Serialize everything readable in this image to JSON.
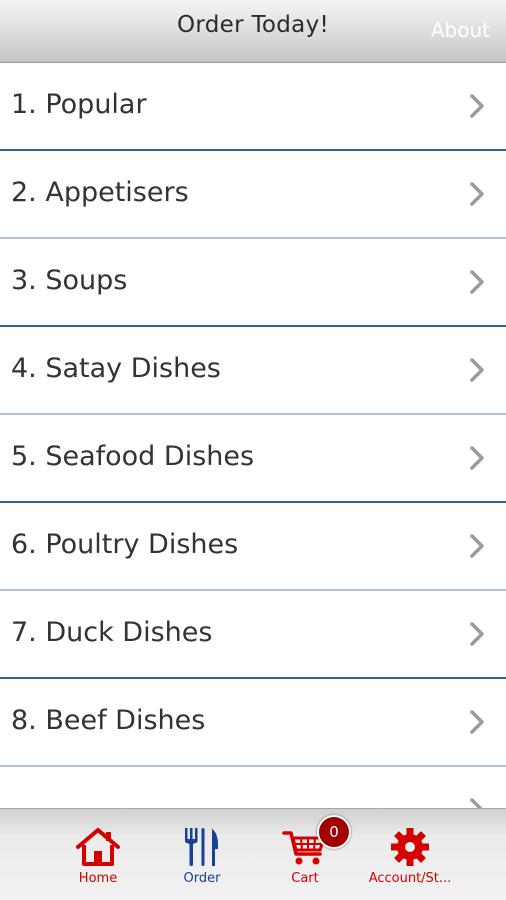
{
  "header": {
    "title": "Order Today!",
    "about_label": "About"
  },
  "menu": {
    "categories": [
      {
        "label": "1. Popular"
      },
      {
        "label": "2. Appetisers"
      },
      {
        "label": "3. Soups"
      },
      {
        "label": "4. Satay Dishes"
      },
      {
        "label": "5. Seafood Dishes"
      },
      {
        "label": "6. Poultry Dishes"
      },
      {
        "label": "7. Duck Dishes"
      },
      {
        "label": "8. Beef Dishes"
      },
      {
        "label": ""
      }
    ]
  },
  "tabbar": {
    "home_label": "Home",
    "order_label": "Order",
    "cart_label": "Cart",
    "cart_count": "0",
    "account_label": "Account/St..."
  },
  "colors": {
    "accent_red": "#d40000",
    "accent_blue": "#1a3f9a",
    "divider_blue": "#2d5fae"
  },
  "icons": {
    "home": "home-icon",
    "order": "fork-knife-icon",
    "cart": "cart-icon",
    "account": "gear-icon",
    "row": "chevron-right-icon"
  }
}
